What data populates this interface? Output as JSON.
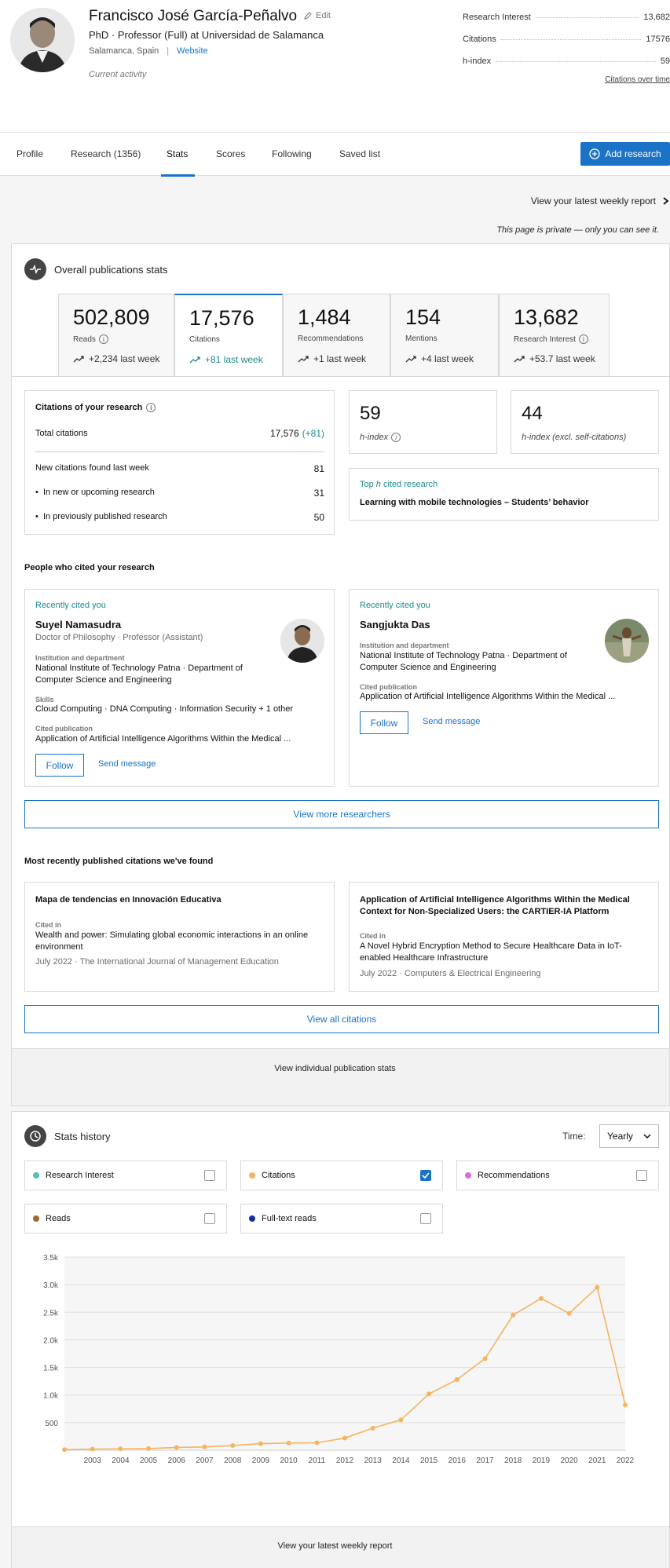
{
  "profile": {
    "name": "Francisco José García-Peñalvo",
    "edit_label": "Edit",
    "title": "PhD · Professor (Full) at Universidad de Salamanca",
    "location": "Salamanca, Spain",
    "separator": "|",
    "website_label": "Website",
    "activity": "Current activity"
  },
  "summary": {
    "rows": [
      {
        "label": "Research Interest",
        "value": "13,682"
      },
      {
        "label": "Citations",
        "value": "17576"
      },
      {
        "label": "h-index",
        "value": "59"
      }
    ],
    "link": "Citations over time"
  },
  "tabs": {
    "items": [
      "Profile",
      "Research (1356)",
      "Stats",
      "Scores",
      "Following",
      "Saved list"
    ],
    "active": "Stats",
    "add_button": "Add research"
  },
  "weekly_report_top": "View your latest weekly report",
  "private_note": "This page is private — only you can see it.",
  "overall": {
    "title": "Overall publications stats",
    "stats": [
      {
        "value": "502,809",
        "label": "Reads",
        "trend": "+2,234 last week",
        "info": true
      },
      {
        "value": "17,576",
        "label": "Citations",
        "trend": "+81 last week",
        "info": false
      },
      {
        "value": "1,484",
        "label": "Recommendations",
        "trend": "+1 last week",
        "info": false
      },
      {
        "value": "154",
        "label": "Mentions",
        "trend": "+4 last week",
        "info": false
      },
      {
        "value": "13,682",
        "label": "Research Interest",
        "trend": "+53.7 last week",
        "info": true
      }
    ]
  },
  "citations_box": {
    "title": "Citations of your research",
    "total_label": "Total citations",
    "total_value": "17,576",
    "total_delta": "(+81)",
    "new_label": "New citations found last week",
    "new_value": "81",
    "upcoming_label": "In new or upcoming research",
    "upcoming_value": "31",
    "previous_label": "In previously published research",
    "previous_value": "50"
  },
  "hindex": {
    "value": "59",
    "label": "h-index"
  },
  "hindex_excl": {
    "value": "44",
    "label": "h-index (excl. self-citations)"
  },
  "top_cited": {
    "label_pre": "Top ",
    "label_h": "h",
    "label_post": " cited research",
    "title": "Learning with mobile technologies – Students’ behavior"
  },
  "people": {
    "heading": "People who cited your research",
    "cards": [
      {
        "tag": "Recently cited you",
        "name": "Suyel Namasudra",
        "position": "Doctor of Philosophy · Professor (Assistant)",
        "inst_label": "Institution and department",
        "inst": "National Institute of Technology Patna · Department of Computer Science and Engineering",
        "skills_label": "Skills",
        "skills": "Cloud Computing · DNA Computing · Information Security + 1 other",
        "pub_label": "Cited publication",
        "pub": "Application of Artificial Intelligence Algorithms Within the Medical ...",
        "follow": "Follow",
        "message": "Send message"
      },
      {
        "tag": "Recently cited you",
        "name": "Sangjukta Das",
        "inst_label": "Institution and department",
        "inst": "National Institute of Technology Patna · Department of Computer Science and Engineering",
        "pub_label": "Cited publication",
        "pub": "Application of Artificial Intelligence Algorithms Within the Medical ...",
        "follow": "Follow",
        "message": "Send message"
      }
    ],
    "more_button": "View more researchers"
  },
  "recent_citations": {
    "heading": "Most recently published citations we've found",
    "cards": [
      {
        "title": "Mapa de tendencias en Innovación Educativa",
        "cited_label": "Cited in",
        "cited": "Wealth and power: Simulating global economic interactions in an online environment",
        "meta": "July 2022 · The International Journal of Management Education"
      },
      {
        "title": "Application of Artificial Intelligence Algorithms Within the Medical Context for Non-Specialized Users: the CARTIER-IA Platform",
        "cited_label": "Cited in",
        "cited": "A Novel Hybrid Encryption Method to Secure Healthcare Data in IoT-enabled Healthcare Infrastructure",
        "meta": "July 2022 · Computers & Electrical Engineering"
      }
    ],
    "all_button": "View all citations",
    "individual_link": "View individual publication stats"
  },
  "history": {
    "title": "Stats history",
    "time_label": "Time:",
    "time_value": "Yearly",
    "filters": [
      {
        "label": "Research Interest",
        "color": "#4fc3b5",
        "checked": false
      },
      {
        "label": "Citations",
        "color": "#f5b461",
        "checked": true
      },
      {
        "label": "Recommendations",
        "color": "#d96bd9",
        "checked": false
      },
      {
        "label": "Reads",
        "color": "#a0682a",
        "checked": false
      },
      {
        "label": "Full-text reads",
        "color": "#1a2b9a",
        "checked": false
      }
    ],
    "bottom_link": "View your latest weekly report"
  },
  "chart_data": {
    "type": "line",
    "series": [
      {
        "name": "Citations",
        "color": "#f5b461",
        "values": [
          10,
          20,
          25,
          30,
          50,
          60,
          85,
          120,
          130,
          135,
          220,
          400,
          550,
          1020,
          1280,
          1660,
          2450,
          2750,
          2480,
          2950,
          820
        ]
      }
    ],
    "x": [
      "2002",
      "2003",
      "2004",
      "2005",
      "2006",
      "2007",
      "2008",
      "2009",
      "2010",
      "2011",
      "2012",
      "2013",
      "2014",
      "2015",
      "2016",
      "2017",
      "2018",
      "2019",
      "2020",
      "2021",
      "2022"
    ],
    "x_tick_labels": [
      "2003",
      "2004",
      "2005",
      "2006",
      "2007",
      "2008",
      "2009",
      "2010",
      "2011",
      "2012",
      "2013",
      "2014",
      "2015",
      "2016",
      "2017",
      "2018",
      "2019",
      "2020",
      "2021",
      "2022"
    ],
    "y_tick_labels": [
      "500",
      "1.0k",
      "1.5k",
      "2.0k",
      "2.5k",
      "3.0k",
      "3.5k"
    ],
    "y_ticks": [
      500,
      1000,
      1500,
      2000,
      2500,
      3000,
      3500
    ],
    "ylim": [
      0,
      3500
    ],
    "grid": true
  }
}
